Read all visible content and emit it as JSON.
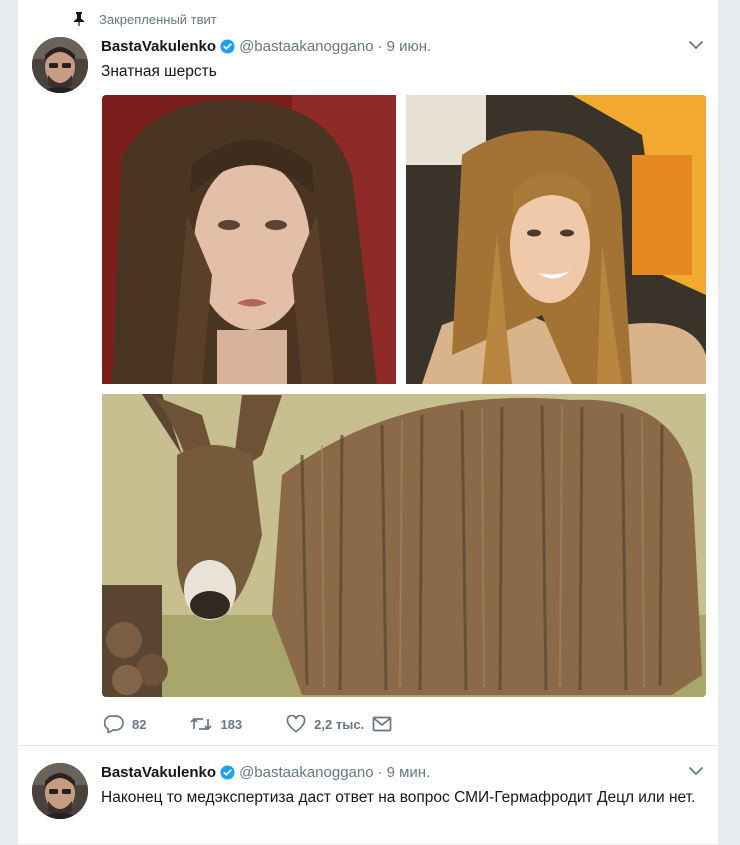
{
  "tweets": [
    {
      "pinned_label": "Закрепленный твит",
      "name": "BastaVakulenko",
      "handle": "@bastaakanoggano",
      "separator": "·",
      "time": "9 июн.",
      "text": "Знатная шерсть",
      "actions": {
        "replies": "82",
        "retweets": "183",
        "likes": "2,2 тыс."
      }
    },
    {
      "name": "BastaVakulenko",
      "handle": "@bastaakanoggano",
      "separator": "·",
      "time": "9 мин.",
      "text": "Наконец то медэкспертиза даст ответ на вопрос СМИ-Гермафродит Децл или нет."
    }
  ],
  "icons": {
    "pin": "pin-icon",
    "verified": "verified-badge-icon",
    "caret": "chevron-down-icon",
    "reply": "reply-icon",
    "retweet": "retweet-icon",
    "like": "heart-icon",
    "dm": "envelope-icon"
  },
  "colors": {
    "verified": "#1da1f2",
    "secondary_text": "#657786",
    "background": "#e6ecf0"
  }
}
